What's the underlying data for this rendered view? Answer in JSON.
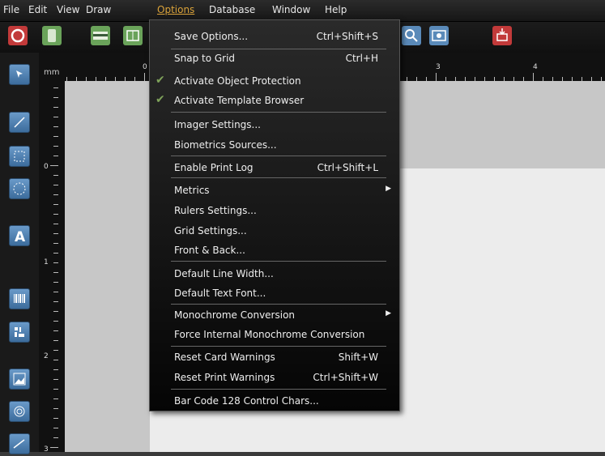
{
  "menubar": {
    "items": [
      {
        "label": "File"
      },
      {
        "label": "Edit"
      },
      {
        "label": "View"
      },
      {
        "label": "Draw"
      },
      {
        "label": "Options"
      },
      {
        "label": "Database"
      },
      {
        "label": "Window"
      },
      {
        "label": "Help"
      }
    ]
  },
  "ruler": {
    "unit": "mm",
    "h_labels": [
      "0",
      "3",
      "4"
    ],
    "v_labels": [
      "0",
      "1",
      "2",
      "3"
    ]
  },
  "options_menu": {
    "items": [
      {
        "label": "Save Options...",
        "shortcut": "Ctrl+Shift+S"
      },
      {
        "label": "Snap to Grid",
        "shortcut": "Ctrl+H"
      },
      {
        "label": "Activate Object Protection",
        "checked": true
      },
      {
        "label": "Activate Template Browser",
        "checked": true
      },
      {
        "label": "Imager Settings..."
      },
      {
        "label": "Biometrics Sources..."
      },
      {
        "label": "Enable Print Log",
        "shortcut": "Ctrl+Shift+L"
      },
      {
        "label": "Metrics",
        "submenu": true
      },
      {
        "label": "Rulers Settings..."
      },
      {
        "label": "Grid Settings..."
      },
      {
        "label": "Front & Back..."
      },
      {
        "label": "Default Line Width..."
      },
      {
        "label": "Default Text Font..."
      },
      {
        "label": "Monochrome Conversion",
        "submenu": true
      },
      {
        "label": "Force Internal Monochrome Conversion"
      },
      {
        "label": "Reset Card Warnings",
        "shortcut": "Shift+W"
      },
      {
        "label": "Reset Print Warnings",
        "shortcut": "Ctrl+Shift+W"
      },
      {
        "label": "Bar Code 128 Control Chars..."
      }
    ],
    "check_glyph": "✔",
    "arrow_glyph": "▶"
  },
  "colors": {
    "active_menu": "#d9a23a",
    "tool_blue": "#5a8ab9",
    "toolbar_green": "#6aa35a",
    "toolbar_red": "#c23a3a"
  }
}
